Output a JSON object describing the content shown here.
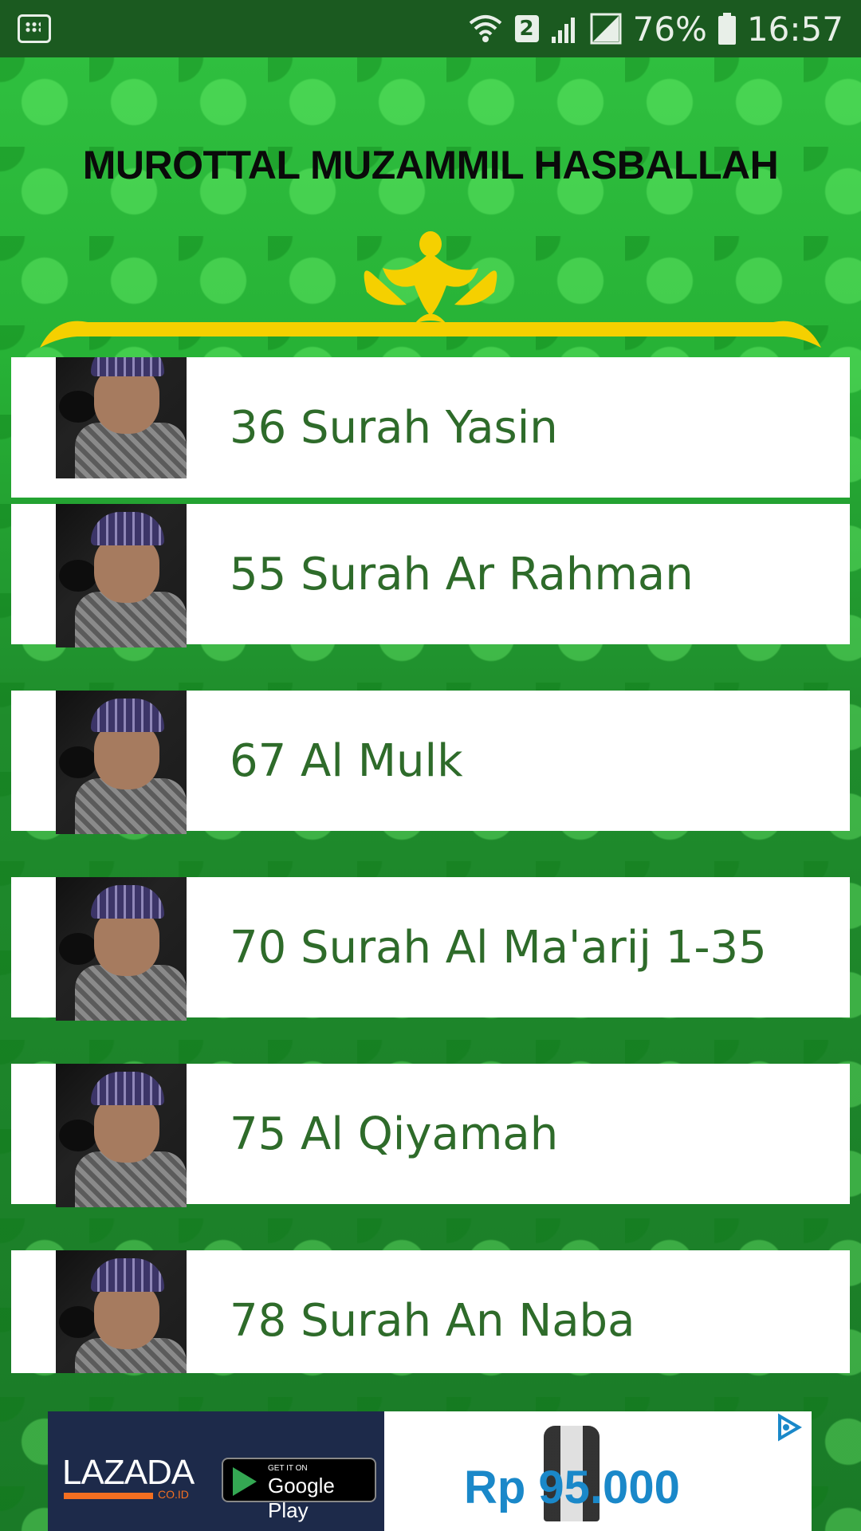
{
  "status_bar": {
    "notification_badge": "2",
    "battery_percent": "76%",
    "time": "16:57",
    "icons": [
      "bbm-icon",
      "wifi-icon",
      "signal-icon",
      "sim-icon",
      "battery-icon"
    ]
  },
  "header": {
    "title": "MUROTTAL MUZAMMIL HASBALLAH"
  },
  "list": {
    "items": [
      {
        "label": "36 Surah Yasin"
      },
      {
        "label": "55 Surah Ar Rahman"
      },
      {
        "label": "67 Al Mulk"
      },
      {
        "label": "70 Surah Al Ma'arij 1-35"
      },
      {
        "label": "75 Al Qiyamah"
      },
      {
        "label": "78 Surah An Naba"
      }
    ]
  },
  "ad": {
    "brand": "LAZADA",
    "brand_suffix": "CO.ID",
    "store_badge_small": "GET IT ON",
    "store_badge_big": "Google Play",
    "price": "Rp 95.000"
  },
  "colors": {
    "status_bar": "#1b5a20",
    "item_text": "#2e6b2a",
    "price": "#1a88c9",
    "ornament_gold": "#f5d000"
  }
}
